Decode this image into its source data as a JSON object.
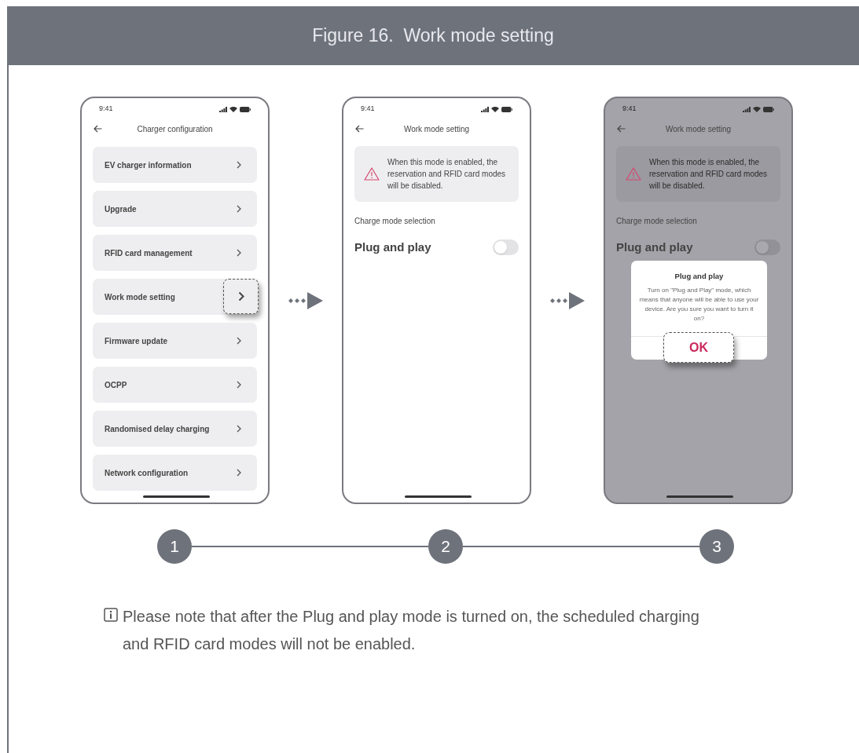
{
  "figure": {
    "title": "Figure 16.  Work mode setting"
  },
  "screens": [
    {
      "kind": "menu",
      "time": "9:41",
      "title": "Charger configuration",
      "items": [
        {
          "label": "EV charger information",
          "highlighted": false
        },
        {
          "label": "Upgrade",
          "highlighted": false
        },
        {
          "label": "RFID card management",
          "highlighted": false
        },
        {
          "label": "Work mode setting",
          "highlighted": true
        },
        {
          "label": "Firmware update",
          "highlighted": false
        },
        {
          "label": "OCPP",
          "highlighted": false
        },
        {
          "label": "Randomised delay charging",
          "highlighted": false
        },
        {
          "label": "Network configuration",
          "highlighted": false
        }
      ]
    },
    {
      "kind": "settings",
      "time": "9:41",
      "title": "Work mode setting",
      "warning": "When this mode is enabled, the reservation and RFID card modes will be disabled.",
      "section": "Charge mode selection",
      "option": "Plug and play",
      "on": false
    },
    {
      "kind": "dialog",
      "time": "9:41",
      "title": "Work mode setting",
      "warning": "When this mode is enabled, the reservation and RFID card modes will be disabled.",
      "section": "Charge mode selection",
      "option": "Plug and play",
      "on": false,
      "dialog": {
        "title": "Plug and play",
        "message": "Turn on \"Plug and Play\" mode, which means that anyone will be able to use your device. Are you sure you want to turn it on?",
        "button": "OK"
      }
    }
  ],
  "steps": [
    "1",
    "2",
    "3"
  ],
  "note": "Please note that after the Plug and play mode is turned on, the scheduled charging and RFID card modes will not be enabled."
}
